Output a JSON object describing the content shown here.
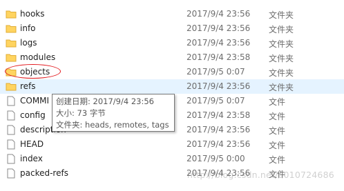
{
  "files": [
    {
      "name": "hooks",
      "date": "2017/9/4 23:56",
      "type": "文件夹",
      "kind": "folder"
    },
    {
      "name": "info",
      "date": "2017/9/4 23:56",
      "type": "文件夹",
      "kind": "folder"
    },
    {
      "name": "logs",
      "date": "2017/9/4 23:56",
      "type": "文件夹",
      "kind": "folder"
    },
    {
      "name": "modules",
      "date": "2017/9/4 23:58",
      "type": "文件夹",
      "kind": "folder"
    },
    {
      "name": "objects",
      "date": "2017/9/5 0:07",
      "type": "文件夹",
      "kind": "folder"
    },
    {
      "name": "refs",
      "date": "2017/9/4 23:56",
      "type": "文件夹",
      "kind": "folder"
    },
    {
      "name": "COMMI",
      "date": "2017/9/5 0:07",
      "type": "文件",
      "kind": "file"
    },
    {
      "name": "config",
      "date": "2017/9/4 23:58",
      "type": "文件",
      "kind": "file"
    },
    {
      "name": "description",
      "date": "2017/9/4 23:56",
      "type": "文件",
      "kind": "file"
    },
    {
      "name": "HEAD",
      "date": "2017/9/4 23:56",
      "type": "文件",
      "kind": "file"
    },
    {
      "name": "index",
      "date": "2017/9/5 0:00",
      "type": "文件",
      "kind": "file"
    },
    {
      "name": "packed-refs",
      "date": "2017/9/4 23:56",
      "type": "文件",
      "kind": "file"
    }
  ],
  "tooltip": {
    "line1": "创建日期: 2017/9/4 23:56",
    "line2": "大小: 73 字节",
    "line3": "文件夹: heads, remotes, tags"
  },
  "watermark": "http://blog.csdn.net/u010724686",
  "colors": {
    "folder": "#ffd460",
    "selected_row": "#e5f3ff",
    "ring": "#e2161b"
  }
}
